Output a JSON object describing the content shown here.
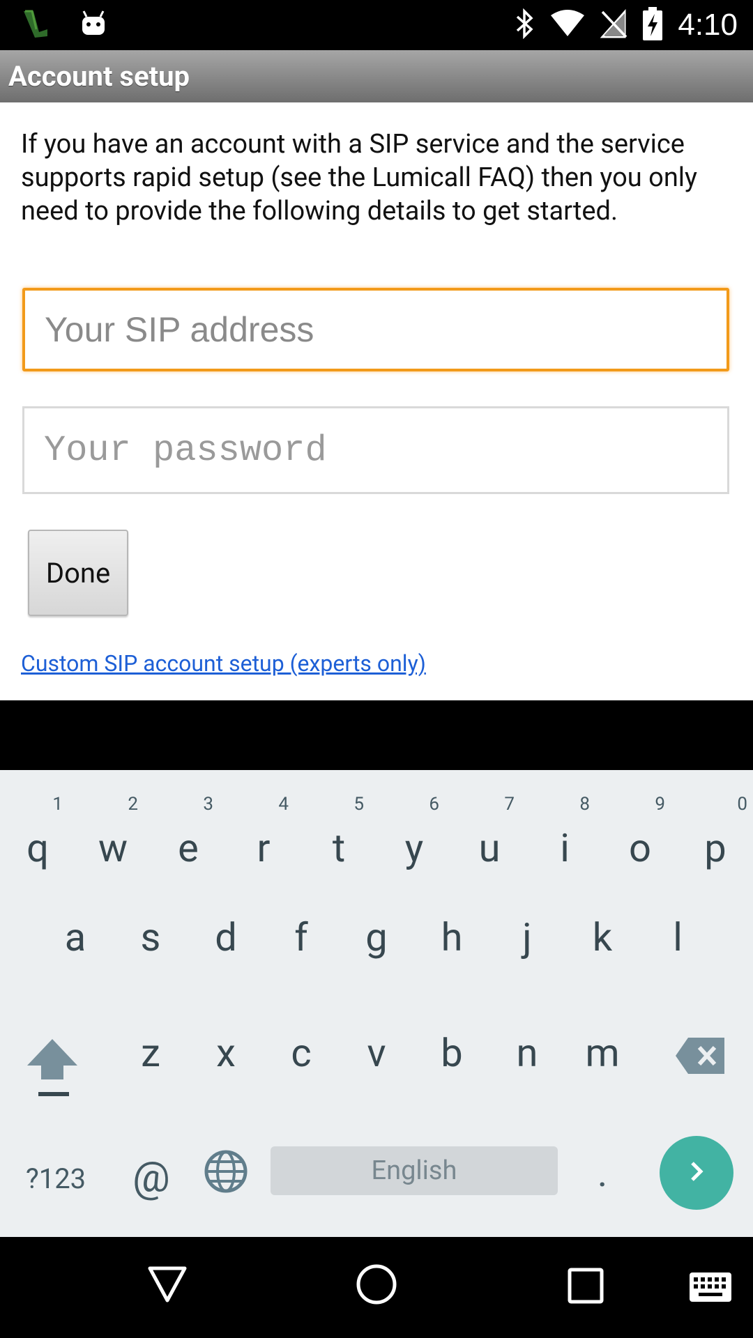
{
  "status_bar": {
    "time": "4:10",
    "icons": [
      "lumicall-notification-icon",
      "android-icon",
      "bluetooth-icon",
      "wifi-icon",
      "no-sim-icon",
      "battery-charging-icon"
    ]
  },
  "action_bar": {
    "title": "Account setup"
  },
  "content": {
    "intro_text": "If you have an account with a SIP service and the service supports rapid setup (see the Lumicall FAQ) then you only need to provide the following details to get started.",
    "sip_address_placeholder": "Your SIP address",
    "sip_address_value": "",
    "password_placeholder": "Your password",
    "password_value": "",
    "done_label": "Done",
    "custom_link": "Custom SIP account setup (experts only)"
  },
  "keyboard": {
    "row1": [
      {
        "letter": "q",
        "hint": "1"
      },
      {
        "letter": "w",
        "hint": "2"
      },
      {
        "letter": "e",
        "hint": "3"
      },
      {
        "letter": "r",
        "hint": "4"
      },
      {
        "letter": "t",
        "hint": "5"
      },
      {
        "letter": "y",
        "hint": "6"
      },
      {
        "letter": "u",
        "hint": "7"
      },
      {
        "letter": "i",
        "hint": "8"
      },
      {
        "letter": "o",
        "hint": "9"
      },
      {
        "letter": "p",
        "hint": "0"
      }
    ],
    "row2": [
      "a",
      "s",
      "d",
      "f",
      "g",
      "h",
      "j",
      "k",
      "l"
    ],
    "row3": [
      "z",
      "x",
      "c",
      "v",
      "b",
      "n",
      "m"
    ],
    "symbols_label": "?123",
    "at_label": "@",
    "space_label": "English",
    "period_label": ".",
    "accent_color": "#42b3a3"
  },
  "nav_bar": {
    "icons": [
      "back-icon",
      "home-icon",
      "recents-icon",
      "keyboard-icon"
    ]
  }
}
